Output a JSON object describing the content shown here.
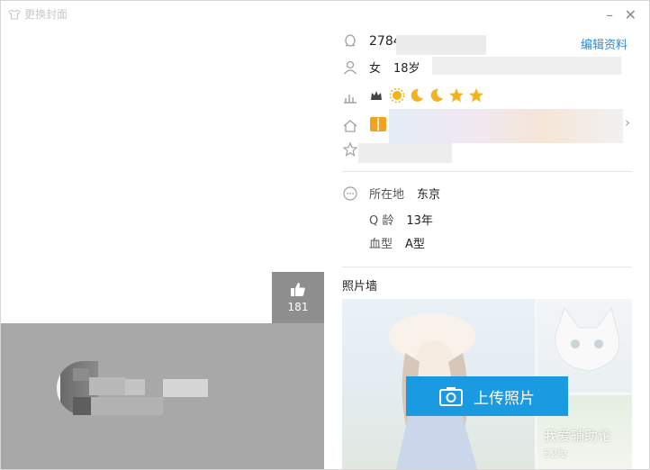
{
  "left": {
    "skin_label": "更换封面",
    "like_count": "181"
  },
  "profile": {
    "qq_prefix": "2784",
    "edit_label": "编辑资料",
    "gender": "女",
    "age": "18岁",
    "location_label": "所在地",
    "location_value": "东京",
    "qage_label": "Q 龄",
    "qage_value": "13年",
    "blood_label": "血型",
    "blood_value": "A型",
    "photo_wall_title": "照片墙",
    "upload_label": "上传照片"
  },
  "level_icons": [
    "crown-icon",
    "sun-icon",
    "moon-icon",
    "moon-icon",
    "star-icon",
    "star-icon"
  ],
  "colors": {
    "link": "#2a8bd5",
    "upload_button": "#1a9ae0",
    "like_box": "#8e8e8e",
    "gold": "#f3b21f"
  },
  "watermark": {
    "line1": "我爱辅助论",
    "line2": "52fz"
  }
}
